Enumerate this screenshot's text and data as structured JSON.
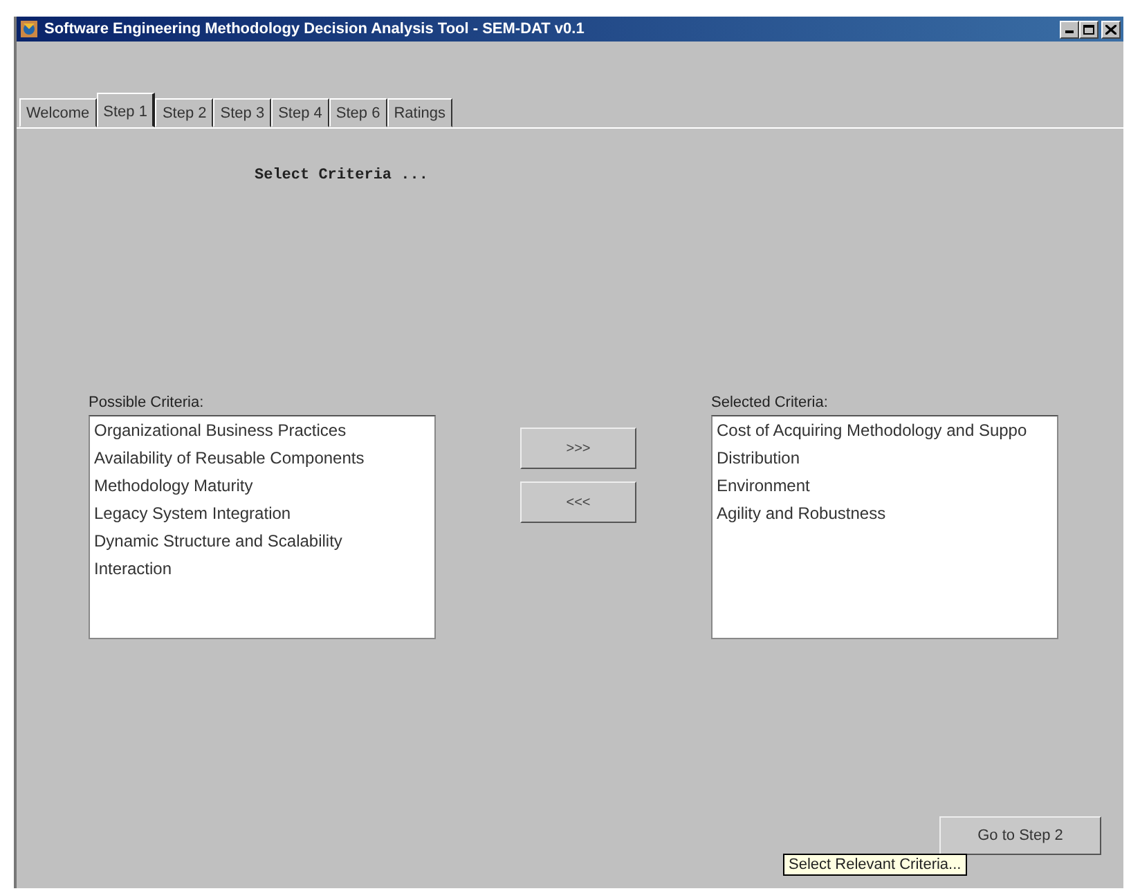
{
  "window": {
    "title": "Software Engineering Methodology Decision Analysis Tool - SEM-DAT v0.1"
  },
  "tabs": [
    {
      "label": "Welcome",
      "selected": false
    },
    {
      "label": "Step 1",
      "selected": true
    },
    {
      "label": "Step 2",
      "selected": false
    },
    {
      "label": "Step 3",
      "selected": false
    },
    {
      "label": "Step 4",
      "selected": false
    },
    {
      "label": "Step 6",
      "selected": false
    },
    {
      "label": "Ratings",
      "selected": false
    }
  ],
  "heading": "Select Criteria ...",
  "possible": {
    "label": "Possible Criteria:",
    "items": [
      "Organizational Business Practices",
      "Availability of Reusable Components",
      "Methodology Maturity",
      "Legacy System Integration",
      "Dynamic Structure and Scalability",
      "Interaction"
    ]
  },
  "move_buttons": [
    ">>>",
    "<<<"
  ],
  "selected_list": {
    "label": "Selected Criteria:",
    "items": [
      "Cost of Acquiring Methodology and Suppo",
      "Distribution",
      "Environment",
      "Agility and Robustness"
    ]
  },
  "next_button": "Go to Step 2",
  "tooltip": "Select Relevant Criteria..."
}
